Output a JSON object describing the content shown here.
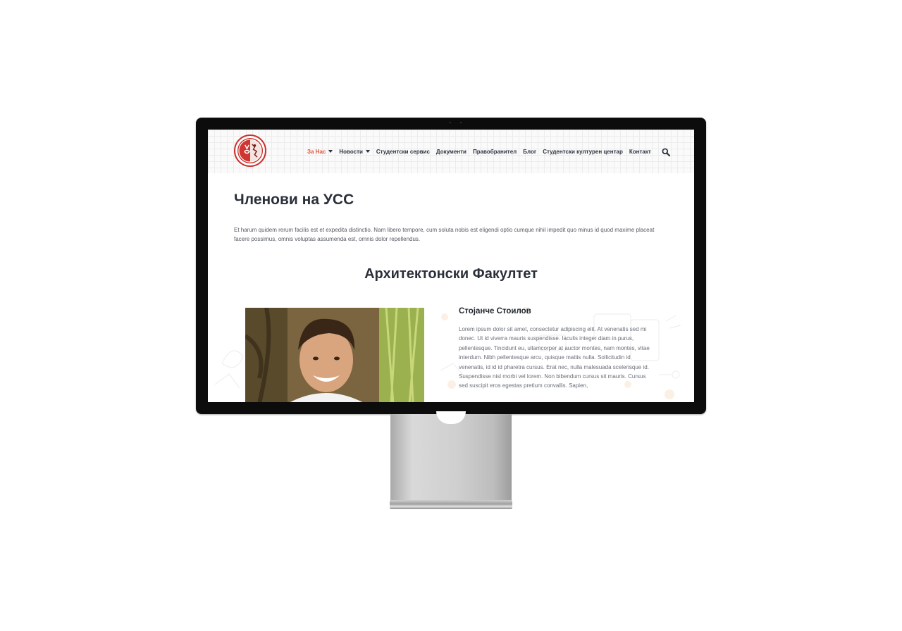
{
  "nav": {
    "items": [
      {
        "label": "За Нас",
        "dropdown": true,
        "active": true
      },
      {
        "label": "Новости",
        "dropdown": true,
        "active": false
      },
      {
        "label": "Студентски сервис",
        "dropdown": false,
        "active": false
      },
      {
        "label": "Документи",
        "dropdown": false,
        "active": false
      },
      {
        "label": "Правобранител",
        "dropdown": false,
        "active": false
      },
      {
        "label": "Блог",
        "dropdown": false,
        "active": false
      },
      {
        "label": "Студентски културен центар",
        "dropdown": false,
        "active": false
      },
      {
        "label": "Контакт",
        "dropdown": false,
        "active": false
      }
    ],
    "search_icon": "search-icon",
    "active_color": "#e0533d"
  },
  "page": {
    "title": "Членови на УСС",
    "intro": "Et harum quidem rerum facilis est et expedita distinctio. Nam libero tempore, cum soluta nobis est eligendi optio cumque nihil impedit quo minus id quod maxime placeat facere possimus, omnis voluptas assumenda est, omnis dolor repellendus."
  },
  "section": {
    "title": "Архитектонски Факултет"
  },
  "member": {
    "name": "Стојанче Стоилов",
    "bio": "Lorem ipsum dolor sit amet, consectetur adipiscing elit. At venenatis sed mi donec. Ut id viverra mauris suspendisse. Iaculis integer diam in purus, pellentesque. Tincidunt eu, ullamcorper at auctor montes, nam montes, vitae interdum. Nibh pellentesque arcu, quisque mattis nulla. Sollicitudin id venenatis, id id id pharetra cursus. Erat nec, nulla malesuada scelerisque id. Suspendisse nisl morbi vel lorem. Non bibendum cursus sit mauris. Cursus sed suscipit eros egestas pretium convallis. Sapien,"
  }
}
